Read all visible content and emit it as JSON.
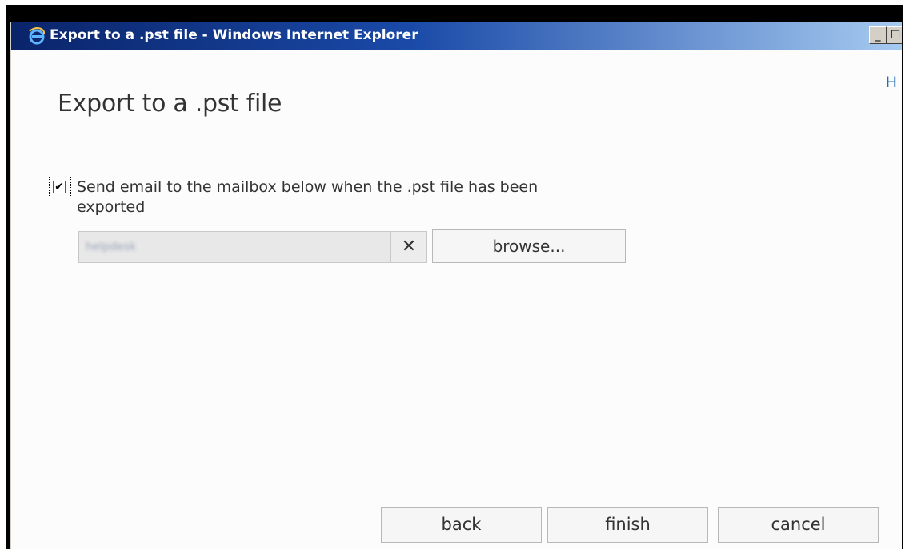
{
  "window": {
    "title": "Export to a .pst file - Windows Internet Explorer",
    "title_icon": "ie-icon",
    "minimize_glyph": "_",
    "maximize_glyph": "☐",
    "help_label": "H"
  },
  "dialog": {
    "title": "Export to a .pst file",
    "checkbox": {
      "checked": true,
      "glyph": "✔",
      "label": "Send email to the mailbox below when the .pst file has been exported"
    },
    "mailbox": {
      "value": "helpdesk",
      "clear_glyph": "✕",
      "browse_label": "browse..."
    }
  },
  "footer": {
    "back_label": "back",
    "finish_label": "finish",
    "cancel_label": "cancel"
  },
  "colors": {
    "titlebar_start": "#0a246a",
    "titlebar_end": "#a6caf0",
    "link": "#1f6fb5"
  }
}
